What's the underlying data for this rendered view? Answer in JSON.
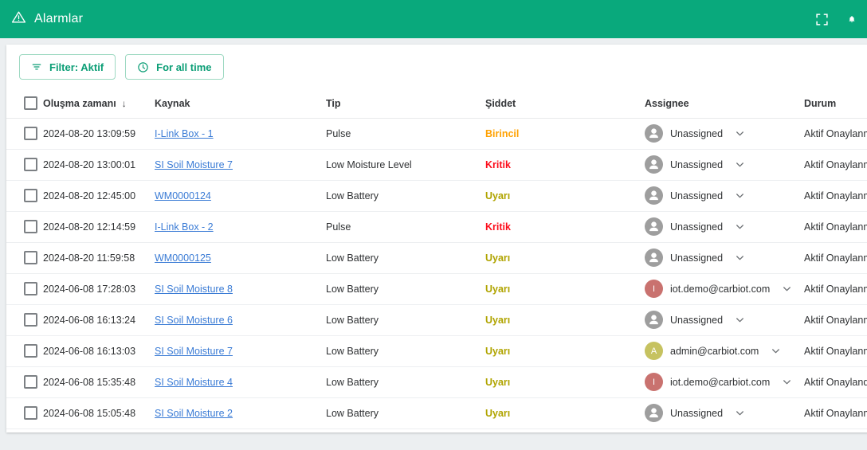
{
  "appbar": {
    "title": "Alarmlar",
    "warning_icon": "warning-triangle-icon",
    "fullscreen_icon": "fullscreen-icon",
    "bell_icon": "notification-bell-icon",
    "background_color": "#09a97c"
  },
  "toolbar": {
    "filter_button": {
      "label": "Filter: Aktif",
      "icon": "filter-funnel-icon"
    },
    "time_button": {
      "label": "For all time",
      "icon": "clock-icon"
    },
    "accent_color": "#0c9e76"
  },
  "table": {
    "columns": [
      {
        "key": "time",
        "label": "Oluşma zamanı",
        "sorted": true,
        "sort_arrow": "↓"
      },
      {
        "key": "source",
        "label": "Kaynak"
      },
      {
        "key": "type",
        "label": "Tip"
      },
      {
        "key": "severity",
        "label": "Şiddet"
      },
      {
        "key": "assignee",
        "label": "Assignee"
      },
      {
        "key": "status",
        "label": "Durum"
      }
    ],
    "severity_colors": {
      "Kritik": "#fc0d1b",
      "Birincil": "#ffa101",
      "Uyarı": "#b0a400"
    },
    "link_color": "#3a7bd5",
    "avatar_colors": {
      "iot.demo@carbiot.com": "#c9726f",
      "admin@carbiot.com": "#c6c260",
      "Unassigned": "#9e9e9e"
    },
    "rows": [
      {
        "time": "2024-08-20 13:09:59",
        "source": "I-Link Box - 1",
        "type": "Pulse",
        "severity": "Birincil",
        "assignee": "Unassigned",
        "avatar_initial": "",
        "status": "Aktif Onaylanmadı"
      },
      {
        "time": "2024-08-20 13:00:01",
        "source": "SI Soil Moisture 7",
        "type": "Low Moisture Level",
        "severity": "Kritik",
        "assignee": "Unassigned",
        "avatar_initial": "",
        "status": "Aktif Onaylanmadı"
      },
      {
        "time": "2024-08-20 12:45:00",
        "source": "WM0000124",
        "type": "Low Battery",
        "severity": "Uyarı",
        "assignee": "Unassigned",
        "avatar_initial": "",
        "status": "Aktif Onaylanmadı"
      },
      {
        "time": "2024-08-20 12:14:59",
        "source": "I-Link Box - 2",
        "type": "Pulse",
        "severity": "Kritik",
        "assignee": "Unassigned",
        "avatar_initial": "",
        "status": "Aktif Onaylanmadı"
      },
      {
        "time": "2024-08-20 11:59:58",
        "source": "WM0000125",
        "type": "Low Battery",
        "severity": "Uyarı",
        "assignee": "Unassigned",
        "avatar_initial": "",
        "status": "Aktif Onaylanmadı"
      },
      {
        "time": "2024-06-08 17:28:03",
        "source": "SI Soil Moisture 8",
        "type": "Low Battery",
        "severity": "Uyarı",
        "assignee": "iot.demo@carbiot.com",
        "avatar_initial": "I",
        "status": "Aktif Onaylanmadı"
      },
      {
        "time": "2024-06-08 16:13:24",
        "source": "SI Soil Moisture 6",
        "type": "Low Battery",
        "severity": "Uyarı",
        "assignee": "Unassigned",
        "avatar_initial": "",
        "status": "Aktif Onaylanmadı"
      },
      {
        "time": "2024-06-08 16:13:03",
        "source": "SI Soil Moisture 7",
        "type": "Low Battery",
        "severity": "Uyarı",
        "assignee": "admin@carbiot.com",
        "avatar_initial": "A",
        "status": "Aktif Onaylanmadı"
      },
      {
        "time": "2024-06-08 15:35:48",
        "source": "SI Soil Moisture 4",
        "type": "Low Battery",
        "severity": "Uyarı",
        "assignee": "iot.demo@carbiot.com",
        "avatar_initial": "I",
        "status": "Aktif Onaylandı"
      },
      {
        "time": "2024-06-08 15:05:48",
        "source": "SI Soil Moisture 2",
        "type": "Low Battery",
        "severity": "Uyarı",
        "assignee": "Unassigned",
        "avatar_initial": "",
        "status": "Aktif Onaylanmadı"
      }
    ]
  }
}
